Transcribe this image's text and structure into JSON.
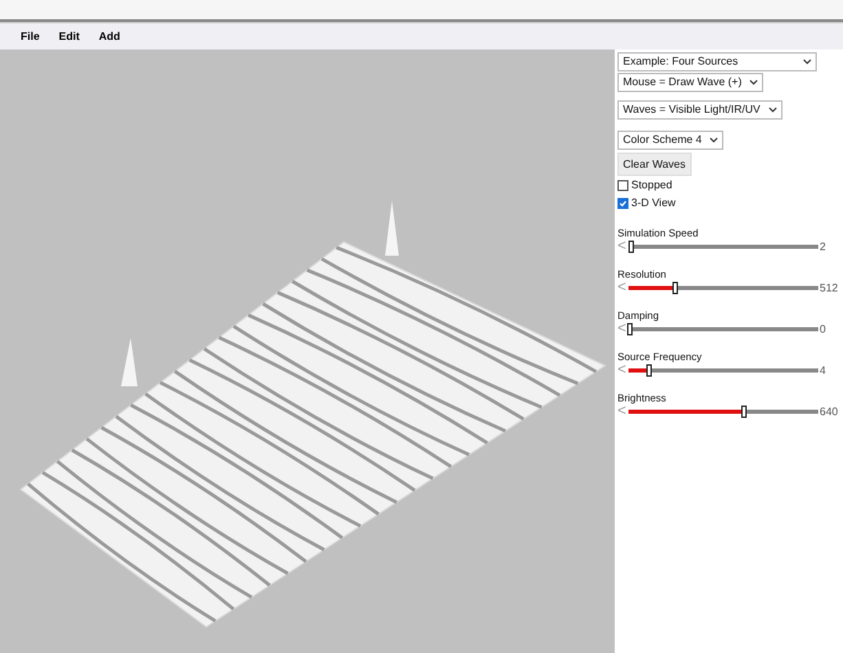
{
  "menu": [
    "File",
    "Edit",
    "Add"
  ],
  "dropdowns": [
    {
      "value": "Example: Four Sources"
    },
    {
      "value": "Mouse = Draw Wave (+)"
    },
    {
      "value": "Waves = Visible Light/IR/UV"
    },
    {
      "value": "Color Scheme 4"
    }
  ],
  "button": "Clear Waves",
  "checkboxes": [
    {
      "label": "Stopped",
      "checked": false
    },
    {
      "label": "3-D View",
      "checked": true
    }
  ],
  "sliders": [
    {
      "label": "Simulation Speed",
      "left": "<",
      "level": 0.01,
      "reading": "2"
    },
    {
      "label": "Resolution",
      "left": "<",
      "level": 0.24,
      "reading": "512"
    },
    {
      "label": "Damping",
      "left": "<",
      "level": 0.0,
      "reading": "0"
    },
    {
      "label": "Source Frequency",
      "left": "<",
      "level": 0.1,
      "reading": "4"
    },
    {
      "label": "Brightness",
      "left": "<",
      "level": 0.6,
      "reading": "640"
    }
  ]
}
